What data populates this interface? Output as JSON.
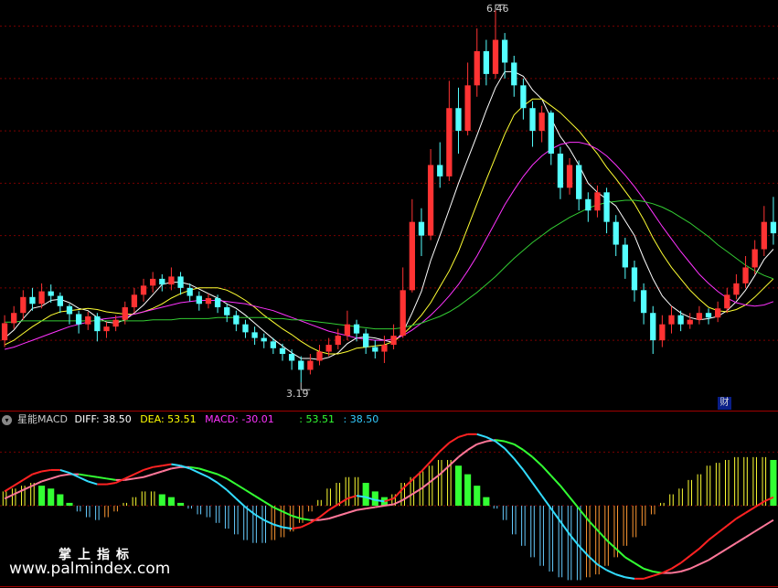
{
  "chart_data": {
    "type": "candlestick",
    "price_panel": {
      "high_annotation": "6.46",
      "low_annotation": "3.19",
      "ylim": [
        2.95,
        6.55
      ],
      "gridlines": [
        6.32,
        5.86,
        5.4,
        4.94,
        4.48,
        4.02,
        3.56
      ],
      "candles": [
        {
          "o": 3.56,
          "c": 3.71,
          "h": 3.78,
          "l": 3.5
        },
        {
          "o": 3.71,
          "c": 3.8,
          "h": 3.86,
          "l": 3.66
        },
        {
          "o": 3.8,
          "c": 3.94,
          "h": 4.0,
          "l": 3.74
        },
        {
          "o": 3.94,
          "c": 3.88,
          "h": 4.02,
          "l": 3.82
        },
        {
          "o": 3.88,
          "c": 3.99,
          "h": 4.06,
          "l": 3.84
        },
        {
          "o": 3.99,
          "c": 3.95,
          "h": 4.05,
          "l": 3.89
        },
        {
          "o": 3.95,
          "c": 3.86,
          "h": 3.98,
          "l": 3.8
        },
        {
          "o": 3.86,
          "c": 3.79,
          "h": 3.88,
          "l": 3.7
        },
        {
          "o": 3.79,
          "c": 3.7,
          "h": 3.82,
          "l": 3.62
        },
        {
          "o": 3.7,
          "c": 3.77,
          "h": 3.81,
          "l": 3.65
        },
        {
          "o": 3.77,
          "c": 3.64,
          "h": 3.8,
          "l": 3.55
        },
        {
          "o": 3.64,
          "c": 3.68,
          "h": 3.72,
          "l": 3.58
        },
        {
          "o": 3.68,
          "c": 3.74,
          "h": 3.78,
          "l": 3.64
        },
        {
          "o": 3.74,
          "c": 3.85,
          "h": 3.9,
          "l": 3.7
        },
        {
          "o": 3.85,
          "c": 3.96,
          "h": 4.02,
          "l": 3.8
        },
        {
          "o": 3.96,
          "c": 4.04,
          "h": 4.1,
          "l": 3.9
        },
        {
          "o": 4.04,
          "c": 4.1,
          "h": 4.16,
          "l": 3.98
        },
        {
          "o": 4.1,
          "c": 4.05,
          "h": 4.14,
          "l": 3.99
        },
        {
          "o": 4.05,
          "c": 4.12,
          "h": 4.2,
          "l": 4.0
        },
        {
          "o": 4.12,
          "c": 4.02,
          "h": 4.16,
          "l": 3.96
        },
        {
          "o": 4.02,
          "c": 3.95,
          "h": 4.06,
          "l": 3.9
        },
        {
          "o": 3.95,
          "c": 3.88,
          "h": 3.99,
          "l": 3.82
        },
        {
          "o": 3.88,
          "c": 3.93,
          "h": 3.97,
          "l": 3.84
        },
        {
          "o": 3.93,
          "c": 3.85,
          "h": 3.96,
          "l": 3.8
        },
        {
          "o": 3.85,
          "c": 3.78,
          "h": 3.88,
          "l": 3.72
        },
        {
          "o": 3.78,
          "c": 3.7,
          "h": 3.82,
          "l": 3.64
        },
        {
          "o": 3.7,
          "c": 3.63,
          "h": 3.74,
          "l": 3.58
        },
        {
          "o": 3.63,
          "c": 3.58,
          "h": 3.68,
          "l": 3.52
        },
        {
          "o": 3.58,
          "c": 3.55,
          "h": 3.62,
          "l": 3.49
        },
        {
          "o": 3.55,
          "c": 3.49,
          "h": 3.58,
          "l": 3.44
        },
        {
          "o": 3.49,
          "c": 3.44,
          "h": 3.53,
          "l": 3.38
        },
        {
          "o": 3.44,
          "c": 3.38,
          "h": 3.48,
          "l": 3.3
        },
        {
          "o": 3.38,
          "c": 3.3,
          "h": 3.42,
          "l": 3.19
        },
        {
          "o": 3.3,
          "c": 3.38,
          "h": 3.44,
          "l": 3.26
        },
        {
          "o": 3.38,
          "c": 3.46,
          "h": 3.52,
          "l": 3.34
        },
        {
          "o": 3.46,
          "c": 3.52,
          "h": 3.58,
          "l": 3.42
        },
        {
          "o": 3.52,
          "c": 3.6,
          "h": 3.66,
          "l": 3.48
        },
        {
          "o": 3.6,
          "c": 3.7,
          "h": 3.82,
          "l": 3.56
        },
        {
          "o": 3.7,
          "c": 3.62,
          "h": 3.74,
          "l": 3.55
        },
        {
          "o": 3.62,
          "c": 3.5,
          "h": 3.66,
          "l": 3.44
        },
        {
          "o": 3.5,
          "c": 3.46,
          "h": 3.56,
          "l": 3.4
        },
        {
          "o": 3.46,
          "c": 3.52,
          "h": 3.6,
          "l": 3.36
        },
        {
          "o": 3.52,
          "c": 3.6,
          "h": 3.7,
          "l": 3.48
        },
        {
          "o": 3.6,
          "c": 4.0,
          "h": 4.2,
          "l": 3.58
        },
        {
          "o": 4.0,
          "c": 4.6,
          "h": 4.8,
          "l": 3.98
        },
        {
          "o": 4.6,
          "c": 4.48,
          "h": 4.72,
          "l": 4.3
        },
        {
          "o": 4.48,
          "c": 5.1,
          "h": 5.24,
          "l": 4.44
        },
        {
          "o": 5.1,
          "c": 5.0,
          "h": 5.3,
          "l": 4.9
        },
        {
          "o": 5.0,
          "c": 5.6,
          "h": 5.84,
          "l": 4.96
        },
        {
          "o": 5.6,
          "c": 5.4,
          "h": 5.78,
          "l": 5.2
        },
        {
          "o": 5.4,
          "c": 5.8,
          "h": 6.0,
          "l": 5.36
        },
        {
          "o": 5.8,
          "c": 6.1,
          "h": 6.3,
          "l": 5.7
        },
        {
          "o": 6.1,
          "c": 5.9,
          "h": 6.2,
          "l": 5.8
        },
        {
          "o": 5.9,
          "c": 6.2,
          "h": 6.46,
          "l": 5.86
        },
        {
          "o": 6.2,
          "c": 6.0,
          "h": 6.26,
          "l": 5.86
        },
        {
          "o": 6.0,
          "c": 5.8,
          "h": 6.06,
          "l": 5.7
        },
        {
          "o": 5.8,
          "c": 5.6,
          "h": 5.86,
          "l": 5.5
        },
        {
          "o": 5.6,
          "c": 5.4,
          "h": 5.66,
          "l": 5.26
        },
        {
          "o": 5.4,
          "c": 5.56,
          "h": 5.62,
          "l": 5.3
        },
        {
          "o": 5.56,
          "c": 5.2,
          "h": 5.58,
          "l": 5.1
        },
        {
          "o": 5.2,
          "c": 4.9,
          "h": 5.26,
          "l": 4.8
        },
        {
          "o": 4.9,
          "c": 5.1,
          "h": 5.16,
          "l": 4.84
        },
        {
          "o": 5.1,
          "c": 4.8,
          "h": 5.14,
          "l": 4.7
        },
        {
          "o": 4.8,
          "c": 4.7,
          "h": 4.86,
          "l": 4.6
        },
        {
          "o": 4.7,
          "c": 4.86,
          "h": 4.92,
          "l": 4.64
        },
        {
          "o": 4.86,
          "c": 4.6,
          "h": 4.9,
          "l": 4.5
        },
        {
          "o": 4.6,
          "c": 4.4,
          "h": 4.66,
          "l": 4.3
        },
        {
          "o": 4.4,
          "c": 4.2,
          "h": 4.46,
          "l": 4.1
        },
        {
          "o": 4.2,
          "c": 4.0,
          "h": 4.26,
          "l": 3.9
        },
        {
          "o": 4.0,
          "c": 3.8,
          "h": 4.06,
          "l": 3.7
        },
        {
          "o": 3.8,
          "c": 3.56,
          "h": 3.86,
          "l": 3.44
        },
        {
          "o": 3.56,
          "c": 3.7,
          "h": 3.78,
          "l": 3.5
        },
        {
          "o": 3.7,
          "c": 3.78,
          "h": 3.86,
          "l": 3.62
        },
        {
          "o": 3.78,
          "c": 3.7,
          "h": 3.82,
          "l": 3.64
        },
        {
          "o": 3.7,
          "c": 3.74,
          "h": 3.8,
          "l": 3.66
        },
        {
          "o": 3.74,
          "c": 3.8,
          "h": 3.86,
          "l": 3.7
        },
        {
          "o": 3.8,
          "c": 3.76,
          "h": 3.84,
          "l": 3.7
        },
        {
          "o": 3.76,
          "c": 3.84,
          "h": 3.9,
          "l": 3.72
        },
        {
          "o": 3.84,
          "c": 3.96,
          "h": 4.02,
          "l": 3.8
        },
        {
          "o": 3.96,
          "c": 4.06,
          "h": 4.14,
          "l": 3.92
        },
        {
          "o": 4.06,
          "c": 4.2,
          "h": 4.3,
          "l": 4.02
        },
        {
          "o": 4.2,
          "c": 4.36,
          "h": 4.44,
          "l": 4.14
        },
        {
          "o": 4.36,
          "c": 4.6,
          "h": 4.74,
          "l": 4.3
        },
        {
          "o": 4.6,
          "c": 4.5,
          "h": 4.82,
          "l": 4.4
        }
      ],
      "ma_lines": [
        {
          "name": "MA5",
          "color": "#ffffff",
          "values": [
            3.58,
            3.65,
            3.75,
            3.84,
            3.86,
            3.91,
            3.92,
            3.89,
            3.84,
            3.82,
            3.76,
            3.72,
            3.71,
            3.74,
            3.8,
            3.87,
            3.96,
            4.05,
            4.07,
            4.07,
            4.05,
            4.01,
            3.97,
            3.93,
            3.88,
            3.84,
            3.78,
            3.71,
            3.64,
            3.57,
            3.51,
            3.45,
            3.4,
            3.4,
            3.39,
            3.41,
            3.45,
            3.53,
            3.58,
            3.59,
            3.58,
            3.56,
            3.54,
            3.63,
            3.8,
            3.99,
            4.26,
            4.48,
            4.71,
            4.94,
            5.15,
            5.36,
            5.58,
            5.78,
            5.92,
            5.92,
            5.88,
            5.76,
            5.68,
            5.51,
            5.35,
            5.24,
            5.1,
            4.94,
            4.86,
            4.8,
            4.74,
            4.61,
            4.48,
            4.28,
            4.1,
            3.95,
            3.86,
            3.8,
            3.76,
            3.74,
            3.75,
            3.77,
            3.82,
            3.9,
            4.0,
            4.13,
            4.27,
            4.36
          ]
        },
        {
          "name": "MA10",
          "color": "#ffff33",
          "values": [
            3.52,
            3.56,
            3.62,
            3.68,
            3.73,
            3.78,
            3.81,
            3.82,
            3.83,
            3.84,
            3.83,
            3.81,
            3.8,
            3.79,
            3.79,
            3.81,
            3.84,
            3.88,
            3.93,
            3.97,
            4.0,
            4.02,
            4.02,
            4.02,
            4.0,
            3.96,
            3.91,
            3.85,
            3.78,
            3.72,
            3.66,
            3.61,
            3.55,
            3.5,
            3.46,
            3.44,
            3.44,
            3.46,
            3.49,
            3.5,
            3.51,
            3.52,
            3.55,
            3.61,
            3.69,
            3.78,
            3.89,
            4.03,
            4.17,
            4.34,
            4.55,
            4.76,
            4.97,
            5.17,
            5.37,
            5.54,
            5.62,
            5.68,
            5.68,
            5.62,
            5.56,
            5.48,
            5.4,
            5.3,
            5.2,
            5.08,
            4.98,
            4.87,
            4.76,
            4.62,
            4.46,
            4.32,
            4.2,
            4.1,
            4.0,
            3.92,
            3.85,
            3.82,
            3.81,
            3.83,
            3.87,
            3.94,
            4.02,
            4.1
          ]
        },
        {
          "name": "MA30",
          "color": "#ff33ff",
          "values": [
            3.48,
            3.5,
            3.53,
            3.56,
            3.59,
            3.62,
            3.65,
            3.68,
            3.7,
            3.72,
            3.74,
            3.75,
            3.76,
            3.77,
            3.79,
            3.81,
            3.83,
            3.85,
            3.87,
            3.89,
            3.9,
            3.91,
            3.91,
            3.91,
            3.9,
            3.89,
            3.88,
            3.86,
            3.84,
            3.82,
            3.79,
            3.76,
            3.73,
            3.7,
            3.67,
            3.64,
            3.62,
            3.6,
            3.58,
            3.57,
            3.56,
            3.56,
            3.57,
            3.6,
            3.65,
            3.71,
            3.78,
            3.86,
            3.95,
            4.05,
            4.17,
            4.3,
            4.45,
            4.6,
            4.75,
            4.88,
            5.0,
            5.1,
            5.18,
            5.24,
            5.28,
            5.3,
            5.3,
            5.28,
            5.24,
            5.18,
            5.1,
            5.01,
            4.91,
            4.8,
            4.68,
            4.56,
            4.45,
            4.34,
            4.24,
            4.14,
            4.06,
            3.99,
            3.93,
            3.89,
            3.87,
            3.86,
            3.87,
            3.9
          ]
        },
        {
          "name": "MA60",
          "color": "#33cc33",
          "values": [
            3.72,
            3.72,
            3.73,
            3.73,
            3.73,
            3.73,
            3.73,
            3.73,
            3.73,
            3.73,
            3.73,
            3.73,
            3.73,
            3.73,
            3.73,
            3.73,
            3.74,
            3.74,
            3.74,
            3.75,
            3.75,
            3.75,
            3.75,
            3.76,
            3.76,
            3.76,
            3.76,
            3.76,
            3.76,
            3.75,
            3.75,
            3.74,
            3.74,
            3.73,
            3.72,
            3.71,
            3.7,
            3.69,
            3.68,
            3.67,
            3.66,
            3.66,
            3.66,
            3.67,
            3.69,
            3.71,
            3.74,
            3.77,
            3.81,
            3.86,
            3.92,
            3.98,
            4.05,
            4.12,
            4.2,
            4.28,
            4.35,
            4.42,
            4.48,
            4.54,
            4.59,
            4.64,
            4.68,
            4.72,
            4.75,
            4.77,
            4.78,
            4.79,
            4.79,
            4.78,
            4.76,
            4.73,
            4.69,
            4.64,
            4.59,
            4.53,
            4.47,
            4.4,
            4.34,
            4.28,
            4.22,
            4.17,
            4.13,
            4.1
          ]
        }
      ]
    },
    "macd_panel": {
      "indicator_name": "星能MACD",
      "labels": [
        {
          "text": "DIFF: 38.50",
          "color": "#ffffff"
        },
        {
          "text": "DEA: 53.51",
          "color": "#ffff00"
        },
        {
          "text": "MACD: -30.01",
          "color": "#ff33ff"
        },
        {
          "text": ": 53.51",
          "color": "#33ff33"
        },
        {
          "text": ": 38.50",
          "color": "#33ccff"
        }
      ],
      "ylim": [
        -115,
        110
      ],
      "gridlines": [
        75,
        0
      ],
      "diff": [
        20,
        28,
        36,
        44,
        48,
        50,
        50,
        46,
        40,
        34,
        30,
        30,
        32,
        38,
        44,
        50,
        54,
        56,
        58,
        56,
        52,
        46,
        40,
        32,
        22,
        10,
        -2,
        -12,
        -20,
        -26,
        -30,
        -32,
        -30,
        -24,
        -16,
        -6,
        2,
        10,
        14,
        12,
        8,
        6,
        10,
        24,
        36,
        48,
        62,
        76,
        88,
        96,
        100,
        100,
        96,
        90,
        80,
        66,
        50,
        32,
        14,
        -4,
        -22,
        -40,
        -56,
        -70,
        -82,
        -90,
        -96,
        -100,
        -102,
        -102,
        -98,
        -94,
        -88,
        -80,
        -70,
        -60,
        -48,
        -38,
        -28,
        -18,
        -10,
        -2,
        6,
        12
      ],
      "dea": [
        10,
        16,
        22,
        28,
        34,
        38,
        42,
        44,
        44,
        42,
        40,
        38,
        36,
        36,
        38,
        40,
        44,
        48,
        52,
        54,
        54,
        52,
        48,
        44,
        38,
        30,
        22,
        14,
        6,
        -2,
        -8,
        -14,
        -18,
        -20,
        -20,
        -18,
        -14,
        -10,
        -6,
        -4,
        -2,
        0,
        2,
        8,
        16,
        24,
        34,
        44,
        56,
        68,
        78,
        86,
        90,
        92,
        90,
        86,
        78,
        68,
        56,
        42,
        28,
        12,
        -4,
        -20,
        -34,
        -48,
        -60,
        -72,
        -80,
        -88,
        -92,
        -94,
        -94,
        -92,
        -88,
        -82,
        -76,
        -68,
        -60,
        -52,
        -44,
        -36,
        -28,
        -20
      ],
      "hist": [
        20,
        24,
        28,
        32,
        28,
        24,
        16,
        4,
        -8,
        -16,
        -20,
        -16,
        -8,
        4,
        12,
        20,
        20,
        16,
        12,
        4,
        -4,
        -12,
        -16,
        -24,
        -32,
        -40,
        -48,
        -52,
        -52,
        -48,
        -44,
        -36,
        -24,
        -8,
        8,
        24,
        32,
        40,
        40,
        32,
        20,
        12,
        16,
        32,
        40,
        48,
        56,
        64,
        64,
        56,
        44,
        28,
        12,
        -4,
        -20,
        -40,
        -56,
        -72,
        -84,
        -92,
        -100,
        -104,
        -104,
        -100,
        -96,
        -84,
        -72,
        -56,
        -44,
        -28,
        -12,
        4,
        16,
        24,
        36,
        44,
        56,
        60,
        64,
        68,
        68,
        68,
        68,
        64
      ]
    }
  },
  "watermark": {
    "line1": "掌上指标",
    "line2": "www.palmindex.com"
  },
  "finance_button": "财"
}
